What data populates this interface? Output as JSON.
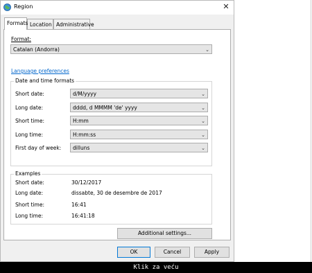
{
  "window": {
    "title": "Region",
    "close_glyph": "✕"
  },
  "tabs": [
    {
      "label": "Formats",
      "active": true
    },
    {
      "label": "Location",
      "active": false
    },
    {
      "label": "Administrative",
      "active": false
    }
  ],
  "format": {
    "label": "Format:",
    "value": "Catalan (Andorra)"
  },
  "language_link": "Language preferences",
  "date_time_formats": {
    "legend": "Date and time formats",
    "rows": [
      {
        "label": "Short date:",
        "value": "d/M/yyyy"
      },
      {
        "label": "Long date:",
        "value": "dddd, d MMMM 'de' yyyy"
      },
      {
        "label": "Short time:",
        "value": "H:mm"
      },
      {
        "label": "Long time:",
        "value": "H:mm:ss"
      },
      {
        "label": "First day of week:",
        "value": "dilluns"
      }
    ]
  },
  "examples": {
    "legend": "Examples",
    "rows": [
      {
        "label": "Short date:",
        "value": "30/12/2017"
      },
      {
        "label": "Long date:",
        "value": "dissabte, 30 de desembre de 2017"
      },
      {
        "label": "Short time:",
        "value": "16:41"
      },
      {
        "label": "Long time:",
        "value": "16:41:18"
      }
    ]
  },
  "buttons": {
    "additional_settings": "Additional settings...",
    "ok": "OK",
    "cancel": "Cancel",
    "apply": "Apply"
  },
  "caption": "Klik za veću",
  "colors": {
    "link": "#0066cc",
    "default_button_border": "#0078d7",
    "caption_bg": "#000000"
  },
  "icons": {
    "window": "globe-icon",
    "dropdown": "chevron-down-icon",
    "close": "close-icon"
  }
}
